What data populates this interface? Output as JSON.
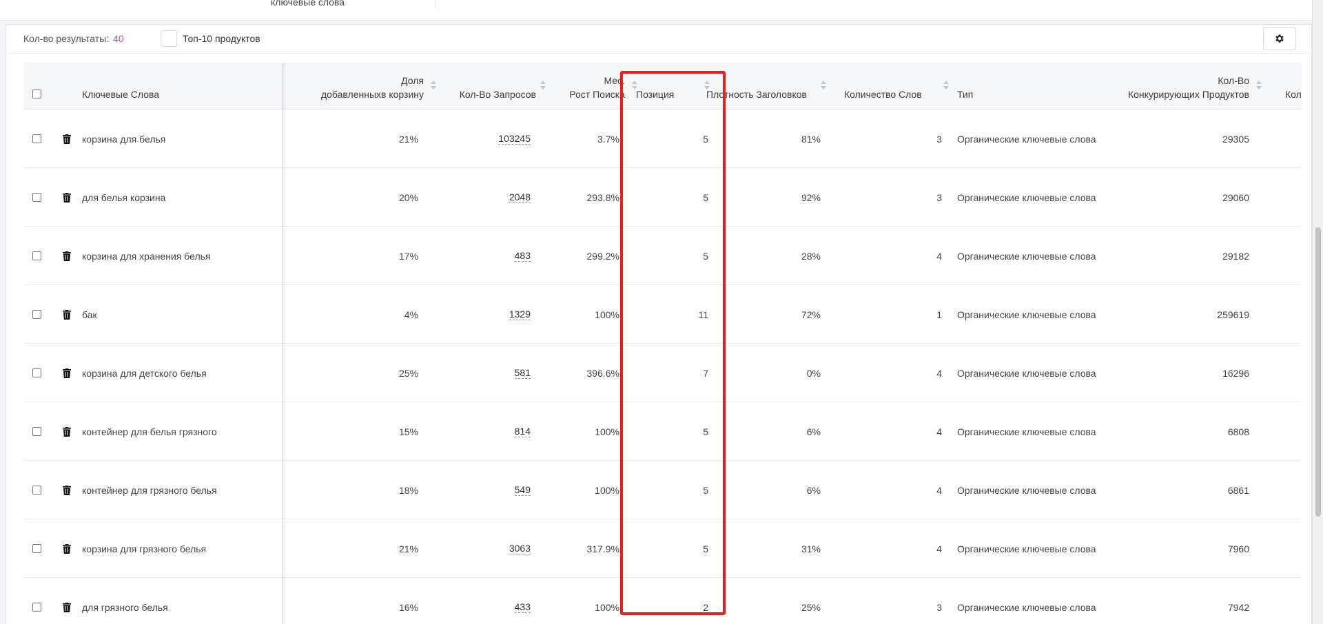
{
  "top": {
    "prev_cell_text": "ключевые слова"
  },
  "toolbar": {
    "results_label": "Кол-во результаты:",
    "results_count": "40",
    "top10_label": "Топ-10 продуктов"
  },
  "icons": {
    "settings": "gear-icon",
    "delete": "trash-icon"
  },
  "colors": {
    "accent_count": "#8a5fa6",
    "highlight": "#e8201d"
  },
  "columns": {
    "keywords": "Ключевые Слова",
    "cart_share_1": "Доля",
    "cart_share_2": "добавленныхв корзину",
    "requests": "Кол-Во Запросов",
    "growth_1": "Мес.",
    "growth_2": "Рост Поиска",
    "position": "Позиция",
    "title_density": "Плотность Заголовков",
    "word_count": "Количество Слов",
    "type": "Тип",
    "competing_1": "Кол-Во",
    "competing_2": "Конкурирующих Продуктов",
    "cut_off": "Кол"
  },
  "rows": [
    {
      "keyword": "корзина для белья",
      "cart_share": "21%",
      "requests": "103245",
      "growth": "3.7%",
      "position": "5",
      "density": "81%",
      "words": "3",
      "type": "Органические ключевые слова",
      "competing": "29305"
    },
    {
      "keyword": "для белья корзина",
      "cart_share": "20%",
      "requests": "2048",
      "growth": "293.8%",
      "position": "5",
      "density": "92%",
      "words": "3",
      "type": "Органические ключевые слова",
      "competing": "29060"
    },
    {
      "keyword": "корзина для хранения белья",
      "cart_share": "17%",
      "requests": "483",
      "growth": "299.2%",
      "position": "5",
      "density": "28%",
      "words": "4",
      "type": "Органические ключевые слова",
      "competing": "29182"
    },
    {
      "keyword": "бак",
      "cart_share": "4%",
      "requests": "1329",
      "growth": "100%",
      "position": "11",
      "density": "72%",
      "words": "1",
      "type": "Органические ключевые слова",
      "competing": "259619"
    },
    {
      "keyword": "корзина для детского белья",
      "cart_share": "25%",
      "requests": "581",
      "growth": "396.6%",
      "position": "7",
      "density": "0%",
      "words": "4",
      "type": "Органические ключевые слова",
      "competing": "16296"
    },
    {
      "keyword": "контейнер для белья грязного",
      "cart_share": "15%",
      "requests": "814",
      "growth": "100%",
      "position": "5",
      "density": "6%",
      "words": "4",
      "type": "Органические ключевые слова",
      "competing": "6808"
    },
    {
      "keyword": "контейнер для грязного белья",
      "cart_share": "18%",
      "requests": "549",
      "growth": "100%",
      "position": "5",
      "density": "6%",
      "words": "4",
      "type": "Органические ключевые слова",
      "competing": "6861"
    },
    {
      "keyword": "корзина для грязного белья",
      "cart_share": "21%",
      "requests": "3063",
      "growth": "317.9%",
      "position": "5",
      "density": "31%",
      "words": "4",
      "type": "Органические ключевые слова",
      "competing": "7960"
    },
    {
      "keyword": "для грязного белья",
      "cart_share": "16%",
      "requests": "433",
      "growth": "100%",
      "position": "2",
      "density": "25%",
      "words": "3",
      "type": "Органические ключевые слова",
      "competing": "7942"
    }
  ]
}
